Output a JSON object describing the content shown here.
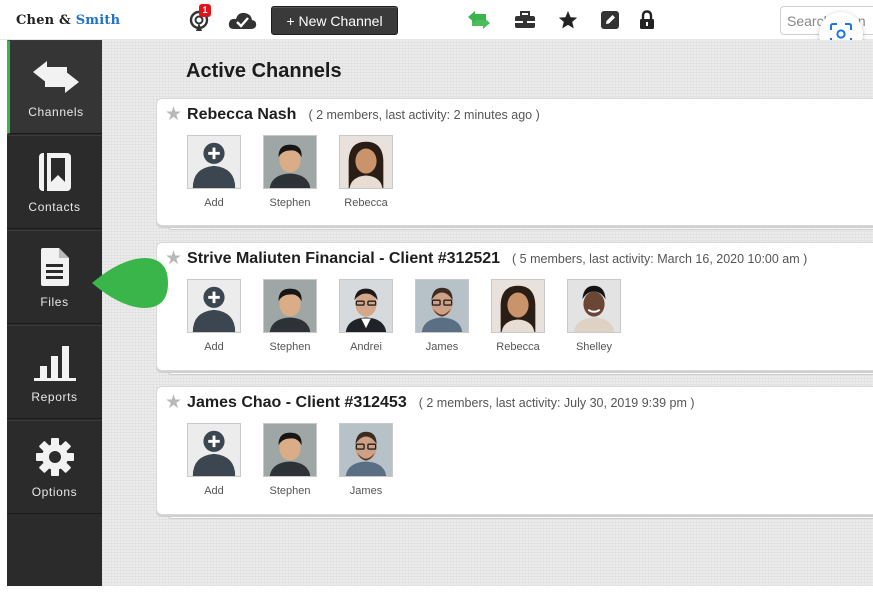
{
  "brand": {
    "part1": "Chen & ",
    "part2": "Smith"
  },
  "topbar": {
    "notification_count": "1",
    "new_channel_label": "+ New Channel",
    "search_placeholder": "Search chan"
  },
  "colors": {
    "accent_green": "#39b54a",
    "brand_blue": "#1e73c8",
    "sidebar_bg": "#2b2b2b",
    "badge_red": "#e0151b"
  },
  "sidebar": {
    "items": [
      {
        "label": "Channels",
        "icon": "swap-arrows-icon"
      },
      {
        "label": "Contacts",
        "icon": "contact-book-icon"
      },
      {
        "label": "Files",
        "icon": "file-icon"
      },
      {
        "label": "Reports",
        "icon": "bar-chart-icon"
      },
      {
        "label": "Options",
        "icon": "gear-icon"
      }
    ]
  },
  "main": {
    "title": "Active Channels",
    "channels": [
      {
        "name": "Rebecca Nash",
        "meta": "( 2 members, last activity: 2 minutes ago )",
        "members": [
          "Add",
          "Stephen",
          "Rebecca"
        ]
      },
      {
        "name": "Strive Maliuten Financial - Client #312521",
        "meta": "( 5 members, last activity: March 16, 2020 10:00 am )",
        "members": [
          "Add",
          "Stephen",
          "Andrei",
          "James",
          "Rebecca",
          "Shelley"
        ]
      },
      {
        "name": "James Chao - Client #312453",
        "meta": "( 2 members, last activity: July 30, 2019 9:39 pm )",
        "members": [
          "Add",
          "Stephen",
          "James"
        ]
      }
    ]
  }
}
